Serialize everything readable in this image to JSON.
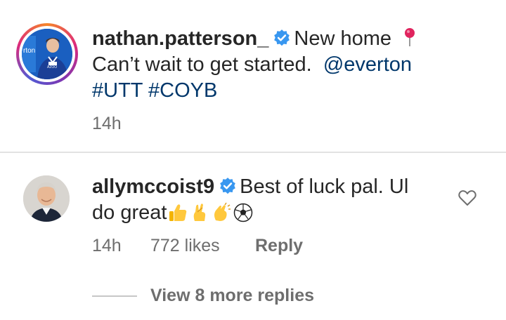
{
  "post": {
    "username": "nathan.patterson_",
    "caption_part1": "New home",
    "caption_part2": "Can’t wait to get started.",
    "mention": "@everton",
    "hashtags": [
      "#UTT",
      "#COYB"
    ],
    "time": "14h",
    "avatar_text": "rton",
    "avatar_badge": "AZOO"
  },
  "comment": {
    "username": "allymccoist9",
    "text_part1": "Best of luck pal.  Ul",
    "text_part2": "do great",
    "emojis": [
      "thumbs-up",
      "crossed-fingers",
      "clapping-hands",
      "soccer-ball"
    ],
    "time": "14h",
    "likes": "772 likes",
    "reply_label": "Reply"
  },
  "view_more_replies": "View 8 more replies",
  "colors": {
    "link": "#00376b",
    "verified": "#3897f0",
    "secondary_text": "#6e6e6e",
    "pin": "#e0245e"
  }
}
